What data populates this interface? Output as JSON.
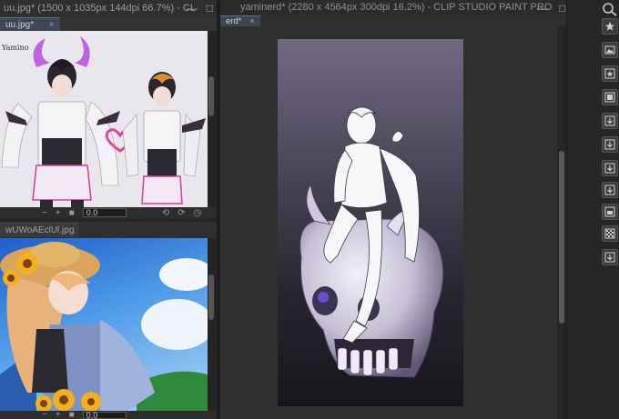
{
  "sub_view_1": {
    "title": "uu.jpg* (1500 x 1035px 144dpi 66.7%) - CL",
    "tab": "uu.jpg*",
    "zoom_value": "0.0",
    "sketch_label": "Yamino"
  },
  "sub_view_2": {
    "tab": "wUWoAEclUl.jpg",
    "zoom_value": "0.0"
  },
  "main_window": {
    "title": "yaminerd* (2280 x 4564px 300dpi 16.2%) - CLIP STUDIO PAINT PRO",
    "tab": "erd*"
  },
  "window_buttons": {
    "minimize": "—",
    "maximize": "□"
  },
  "icons": {
    "tab_close": "×",
    "rotate_left": "⟲",
    "rotate_right": "⟳",
    "reset": "◷",
    "zoom_out": "−",
    "zoom_in": "+",
    "stop": "■",
    "scroll_left": "◂",
    "scroll_right": "▸"
  },
  "colors": {
    "accent_tab": "#3c4856",
    "panel_bg": "#262626",
    "canvas_bg": "#2f2f2f"
  }
}
